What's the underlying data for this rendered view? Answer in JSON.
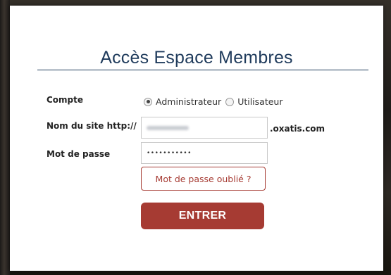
{
  "modal": {
    "title": "Accès Espace Membres"
  },
  "form": {
    "compte_label": "Compte",
    "account_types": [
      {
        "label": "Administrateur",
        "checked": true
      },
      {
        "label": "Utilisateur",
        "checked": false
      }
    ],
    "site_label": "Nom du site http://",
    "site_suffix": ".oxatis.com",
    "password_label": "Mot de passe",
    "password_value": "•••••••••••",
    "forgot_label": "Mot de passe oublié ?",
    "submit_label": "ENTRER"
  },
  "colors": {
    "title": "#1f3b5c",
    "accent": "#a63b33"
  }
}
